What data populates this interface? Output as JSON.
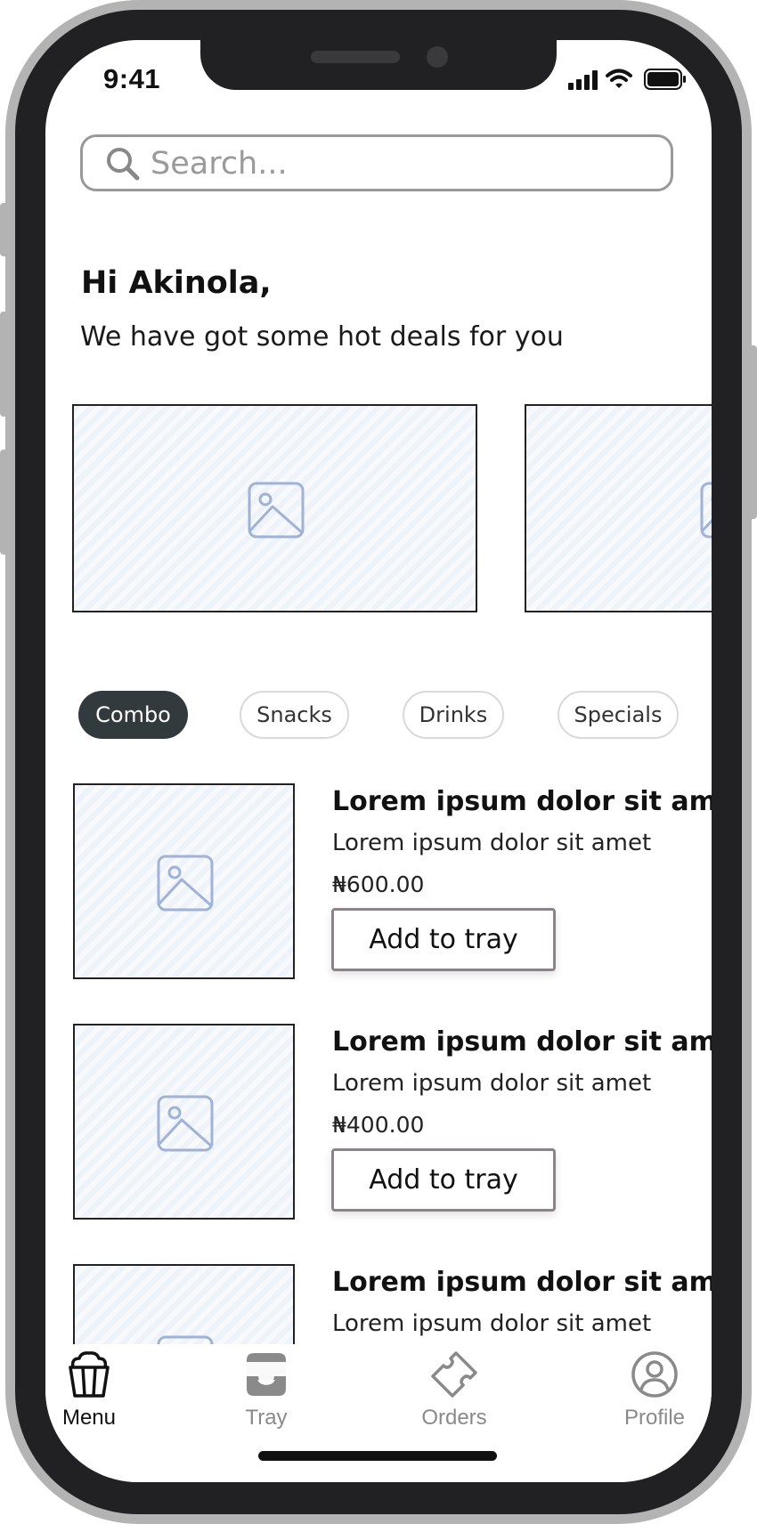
{
  "status_bar": {
    "time": "9:41"
  },
  "search": {
    "placeholder": "Search..."
  },
  "greeting": {
    "title": "Hi Akinola,",
    "subtitle": "We have got some hot deals for you"
  },
  "categories": [
    {
      "label": "Combo",
      "active": true
    },
    {
      "label": "Snacks",
      "active": false
    },
    {
      "label": "Drinks",
      "active": false
    },
    {
      "label": "Specials",
      "active": false
    }
  ],
  "items": [
    {
      "title": "Lorem ipsum dolor sit amet",
      "description": "Lorem ipsum dolor sit amet",
      "price": "600.00",
      "button": "Add to tray"
    },
    {
      "title": "Lorem ipsum dolor sit amet",
      "description": "Lorem ipsum dolor sit amet",
      "price": "400.00",
      "button": "Add to tray"
    },
    {
      "title": "Lorem ipsum dolor sit amet",
      "description": "Lorem ipsum dolor sit amet"
    }
  ],
  "currency_symbol": "₦",
  "tabs": [
    {
      "label": "Menu",
      "icon": "popcorn-icon",
      "active": true
    },
    {
      "label": "Tray",
      "icon": "tray-icon",
      "active": false
    },
    {
      "label": "Orders",
      "icon": "ticket-icon",
      "active": false
    },
    {
      "label": "Profile",
      "icon": "user-circle-icon",
      "active": false
    }
  ],
  "colors": {
    "active_chip": "#333a3d",
    "inactive_tab": "#8a8a8a",
    "placeholder_icon": "#9fb3d9"
  }
}
